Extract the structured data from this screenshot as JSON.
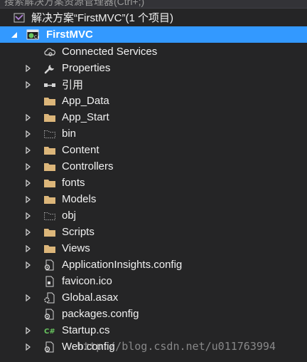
{
  "search": {
    "placeholder": "搜索解决方案资源管理器(Ctrl+;)"
  },
  "solution": {
    "label": "解决方案“FirstMVC”(1 个项目)",
    "icon": "visual-studio-solution-icon"
  },
  "project": {
    "label": "FirstMVC",
    "icon": "csharp-web-project-icon"
  },
  "items": [
    {
      "label": "Connected Services",
      "icon": "cloud-gear-icon",
      "expandable": false
    },
    {
      "label": "Properties",
      "icon": "wrench-icon",
      "expandable": true
    },
    {
      "label": "引用",
      "icon": "references-icon",
      "expandable": true
    },
    {
      "label": "App_Data",
      "icon": "folder-icon",
      "expandable": false
    },
    {
      "label": "App_Start",
      "icon": "folder-icon",
      "expandable": true
    },
    {
      "label": "bin",
      "icon": "hidden-folder-icon",
      "expandable": true
    },
    {
      "label": "Content",
      "icon": "folder-icon",
      "expandable": true
    },
    {
      "label": "Controllers",
      "icon": "folder-icon",
      "expandable": true
    },
    {
      "label": "fonts",
      "icon": "folder-icon",
      "expandable": true
    },
    {
      "label": "Models",
      "icon": "folder-icon",
      "expandable": true
    },
    {
      "label": "obj",
      "icon": "hidden-folder-icon",
      "expandable": true
    },
    {
      "label": "Scripts",
      "icon": "folder-icon",
      "expandable": true
    },
    {
      "label": "Views",
      "icon": "folder-icon",
      "expandable": true
    },
    {
      "label": "ApplicationInsights.config",
      "icon": "config-file-icon",
      "expandable": true
    },
    {
      "label": "favicon.ico",
      "icon": "ico-file-icon",
      "expandable": false
    },
    {
      "label": "Global.asax",
      "icon": "asax-file-icon",
      "expandable": true
    },
    {
      "label": "packages.config",
      "icon": "config-file-icon",
      "expandable": false
    },
    {
      "label": "Startup.cs",
      "icon": "csharp-file-icon",
      "expandable": true
    },
    {
      "label": "Web.config",
      "icon": "config-file-icon",
      "expandable": true
    }
  ],
  "watermark": "http://blog.csdn.net/u011763994",
  "colors": {
    "background": "#252526",
    "selection": "#3399ff",
    "folder": "#dcb67a",
    "text": "#f1f1f1"
  }
}
